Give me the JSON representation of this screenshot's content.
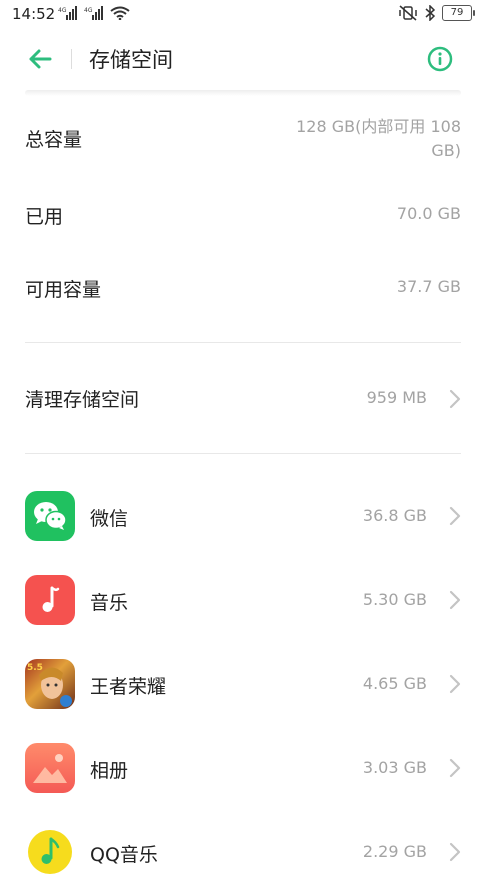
{
  "status_bar": {
    "time": "14:52",
    "signal_1_label": "4G",
    "signal_2_label": "4G",
    "battery": "79"
  },
  "header": {
    "title": "存储空间"
  },
  "storage": {
    "total_label": "总容量",
    "total_value": "128 GB(内部可用 108 GB)",
    "used_label": "已用",
    "used_value": "70.0 GB",
    "available_label": "可用容量",
    "available_value": "37.7 GB"
  },
  "clean": {
    "label": "清理存储空间",
    "value": "959 MB"
  },
  "apps": [
    {
      "name": "微信",
      "size": "36.8 GB",
      "icon": "wechat-icon"
    },
    {
      "name": "音乐",
      "size": "5.30 GB",
      "icon": "music-icon"
    },
    {
      "name": "王者荣耀",
      "size": "4.65 GB",
      "icon": "honor-of-kings-icon"
    },
    {
      "name": "相册",
      "size": "3.03 GB",
      "icon": "photos-icon"
    },
    {
      "name": "QQ音乐",
      "size": "2.29 GB",
      "icon": "qq-music-icon"
    }
  ],
  "colors": {
    "accent": "#2dbd7e",
    "wechat": "#20c160",
    "music": "#f5524f",
    "photos": "#f86d58",
    "qqmusic": "#f6dc1d"
  }
}
